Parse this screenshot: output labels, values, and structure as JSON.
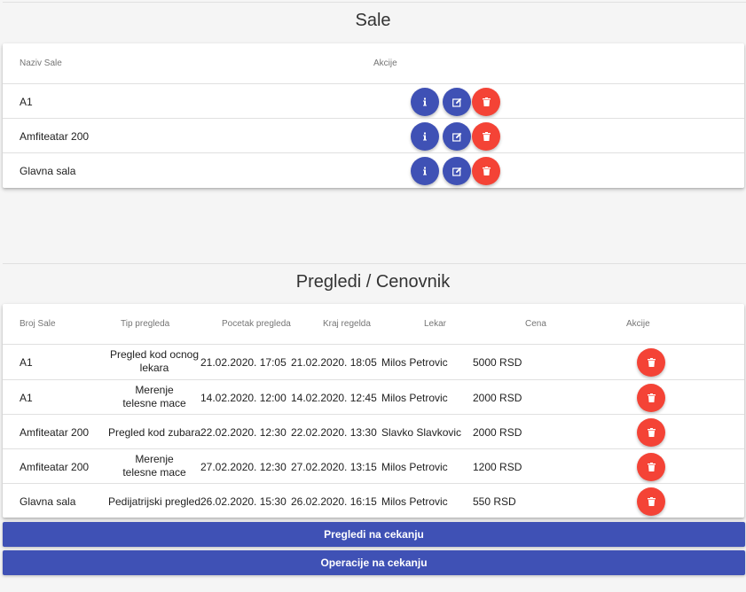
{
  "sale": {
    "title": "Sale",
    "headers": {
      "name": "Naziv Sale",
      "actions": "Akcije"
    },
    "rows": [
      {
        "name": "A1"
      },
      {
        "name": "Amfiteatar 200"
      },
      {
        "name": "Glavna sala"
      }
    ]
  },
  "pregledi": {
    "title": "Pregledi / Cenovnik",
    "headers": {
      "room": "Broj Sale",
      "type": "Tip pregleda",
      "start": "Pocetak pregleda",
      "end": "Kraj regelda",
      "doctor": "Lekar",
      "price": "Cena",
      "actions": "Akcije"
    },
    "rows": [
      {
        "room": "A1",
        "type": "Pregled kod ocnog lekara",
        "start": "21.02.2020. 17:05",
        "end": "21.02.2020. 18:05",
        "doctor": "Milos Petrovic",
        "price": "5000 RSD"
      },
      {
        "room": "A1",
        "type": "Merenje telesne mace",
        "start": "14.02.2020. 12:00",
        "end": "14.02.2020. 12:45",
        "doctor": "Milos Petrovic",
        "price": "2000 RSD"
      },
      {
        "room": "Amfiteatar 200",
        "type": "Pregled kod zubara",
        "start": "22.02.2020. 12:30",
        "end": "22.02.2020. 13:30",
        "doctor": "Slavko Slavkovic",
        "price": "2000 RSD"
      },
      {
        "room": "Amfiteatar 200",
        "type": "Merenje telesne mace",
        "start": "27.02.2020. 12:30",
        "end": "27.02.2020. 13:15",
        "doctor": "Milos Petrovic",
        "price": "1200 RSD"
      },
      {
        "room": "Glavna sala",
        "type": "Pedijatrijski pregled",
        "start": "26.02.2020. 15:30",
        "end": "26.02.2020. 16:15",
        "doctor": "Milos Petrovic",
        "price": "550 RSD"
      }
    ]
  },
  "buttons": {
    "pending_exams": "Pregledi na cekanju",
    "pending_operations": "Operacije na cekanju"
  },
  "colors": {
    "primary": "#3f51b5",
    "danger": "#f44336"
  },
  "icons": {
    "info": "info-icon",
    "edit": "edit-icon",
    "delete": "trash-icon"
  }
}
